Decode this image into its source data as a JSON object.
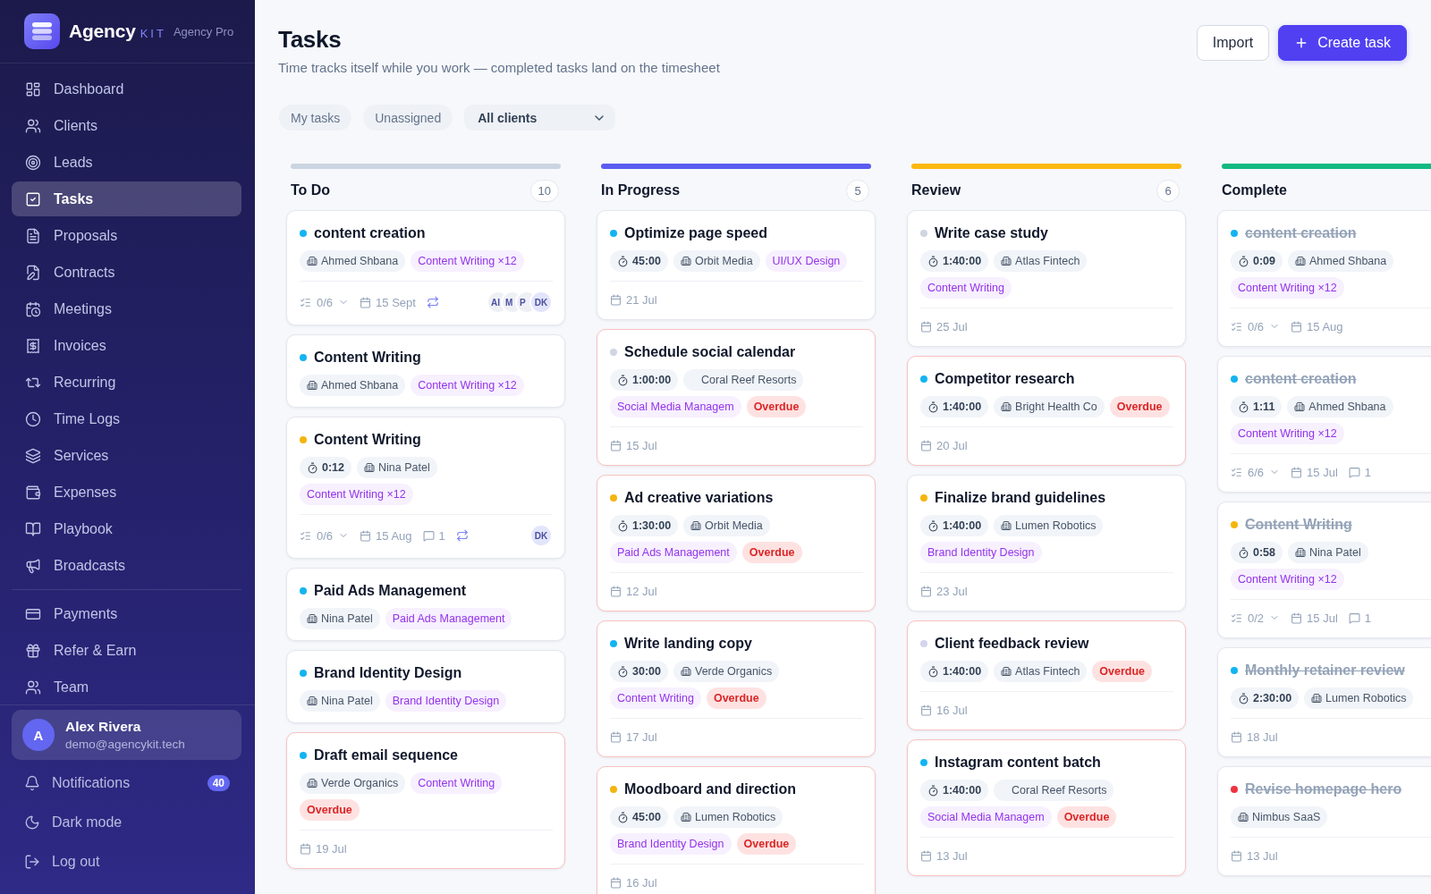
{
  "sidebar": {
    "brand": {
      "name": "Agency",
      "suffix": "KIT",
      "plan": "Agency Pro"
    },
    "nav": [
      {
        "label": "Dashboard",
        "selected": false
      },
      {
        "label": "Clients",
        "selected": false
      },
      {
        "label": "Leads",
        "selected": false
      },
      {
        "label": "Tasks",
        "selected": true
      },
      {
        "label": "Proposals",
        "selected": false
      },
      {
        "label": "Contracts",
        "selected": false
      },
      {
        "label": "Meetings",
        "selected": false
      },
      {
        "label": "Invoices",
        "selected": false
      },
      {
        "label": "Recurring",
        "selected": false
      },
      {
        "label": "Time Logs",
        "selected": false
      },
      {
        "label": "Services",
        "selected": false
      },
      {
        "label": "Expenses",
        "selected": false
      },
      {
        "label": "Playbook",
        "selected": false
      },
      {
        "label": "Broadcasts",
        "selected": false
      }
    ],
    "nav_secondary": [
      {
        "label": "Payments",
        "selected": false
      },
      {
        "label": "Refer & Earn",
        "selected": false
      },
      {
        "label": "Team",
        "selected": false
      }
    ],
    "user": {
      "initial": "A",
      "name": "Alex Rivera",
      "email": "demo@agencykit.tech"
    },
    "footer_links": [
      {
        "label": "Notifications",
        "badge": "40"
      },
      {
        "label": "Dark mode"
      },
      {
        "label": "Log out"
      }
    ]
  },
  "header": {
    "title": "Tasks",
    "subtitle": "Time tracks itself while you work — completed tasks land on the timesheet",
    "actions": [
      {
        "label": "Import",
        "kind": "secondary"
      },
      {
        "label": "Create task",
        "kind": "primary"
      }
    ]
  },
  "filters": {
    "toggles": [
      {
        "label": "My tasks",
        "selected": false
      },
      {
        "label": "Unassigned",
        "selected": false
      }
    ],
    "client_select": {
      "value": "All clients"
    }
  },
  "board": {
    "columns": [
      {
        "title": "To Do",
        "count": "10",
        "color": "#cbd5e1",
        "cards": [
          {
            "title": "content creation",
            "color": "#13b4f2",
            "done": false,
            "overdue": false,
            "chip_rows": [
              [
                {
                  "kind": "client",
                  "text": "Ahmed Shbana"
                },
                {
                  "kind": "tag",
                  "text": "Content Writing ×12"
                }
              ]
            ],
            "footer": {
              "checklist": "0/6",
              "date": "15 Sept",
              "recurring": true,
              "assignees": [
                {
                  "initials": "AI",
                  "color": "#eef0f6"
                },
                {
                  "initials": "M",
                  "color": "#eef0f6"
                },
                {
                  "initials": "P",
                  "color": "#eef0f6"
                },
                {
                  "initials": "DK",
                  "color": "#e2e5fb"
                }
              ]
            }
          },
          {
            "title": "Content Writing",
            "color": "#13b4f2",
            "done": false,
            "overdue": false,
            "chip_rows": [
              [
                {
                  "kind": "client",
                  "text": "Ahmed Shbana"
                },
                {
                  "kind": "tag",
                  "text": "Content Writing ×12"
                }
              ]
            ]
          },
          {
            "title": "Content Writing",
            "color": "#f5b50f",
            "done": false,
            "overdue": false,
            "chip_rows": [
              [
                {
                  "kind": "timer",
                  "text": "0:12"
                },
                {
                  "kind": "client",
                  "text": "Nina Patel"
                }
              ],
              [
                {
                  "kind": "tag",
                  "text": "Content Writing ×12"
                }
              ]
            ],
            "footer": {
              "checklist": "0/6",
              "date": "15 Aug",
              "comments": "1",
              "recurring": true,
              "assignees": [
                {
                  "initials": "DK",
                  "color": "#e2e5fb"
                }
              ]
            }
          },
          {
            "title": "Paid Ads Management",
            "color": "#13b4f2",
            "done": false,
            "overdue": false,
            "chip_rows": [
              [
                {
                  "kind": "client",
                  "text": "Nina Patel"
                },
                {
                  "kind": "tag",
                  "text": "Paid Ads Management"
                }
              ]
            ]
          },
          {
            "title": "Brand Identity Design",
            "color": "#13b4f2",
            "done": false,
            "overdue": false,
            "chip_rows": [
              [
                {
                  "kind": "client",
                  "text": "Nina Patel"
                },
                {
                  "kind": "tag",
                  "text": "Brand Identity Design"
                }
              ]
            ]
          },
          {
            "title": "Draft email sequence",
            "color": "#13b4f2",
            "done": false,
            "overdue": true,
            "chip_rows": [
              [
                {
                  "kind": "client",
                  "text": "Verde Organics"
                },
                {
                  "kind": "tag",
                  "text": "Content Writing"
                }
              ],
              [
                {
                  "kind": "overdue",
                  "text": "Overdue"
                }
              ]
            ],
            "footer": {
              "date": "19 Jul"
            }
          }
        ]
      },
      {
        "title": "In Progress",
        "count": "5",
        "color": "#5b5cf0",
        "cards": [
          {
            "title": "Optimize page speed",
            "color": "#13b4f2",
            "done": false,
            "overdue": false,
            "chip_rows": [
              [
                {
                  "kind": "timer",
                  "text": "45:00"
                },
                {
                  "kind": "client",
                  "text": "Orbit Media"
                },
                {
                  "kind": "tag",
                  "text": "UI/UX Design"
                }
              ]
            ],
            "footer": {
              "date": "21 Jul"
            }
          },
          {
            "title": "Schedule social calendar",
            "color": "#cfd6e2",
            "done": false,
            "overdue": true,
            "chip_rows": [
              [
                {
                  "kind": "timer",
                  "text": "1:00:00"
                },
                {
                  "kind": "plain",
                  "text": "Coral Reef Resorts"
                }
              ],
              [
                {
                  "kind": "tag",
                  "text": "Social Media Managem"
                },
                {
                  "kind": "overdue",
                  "text": "Overdue"
                }
              ]
            ],
            "footer": {
              "date": "15 Jul"
            }
          },
          {
            "title": "Ad creative variations",
            "color": "#f5b50f",
            "done": false,
            "overdue": true,
            "chip_rows": [
              [
                {
                  "kind": "timer",
                  "text": "1:30:00"
                },
                {
                  "kind": "client",
                  "text": "Orbit Media"
                }
              ],
              [
                {
                  "kind": "tag",
                  "text": "Paid Ads Management"
                },
                {
                  "kind": "overdue",
                  "text": "Overdue"
                }
              ]
            ],
            "footer": {
              "date": "12 Jul"
            }
          },
          {
            "title": "Write landing copy",
            "color": "#13b4f2",
            "done": false,
            "overdue": true,
            "chip_rows": [
              [
                {
                  "kind": "timer",
                  "text": "30:00"
                },
                {
                  "kind": "client",
                  "text": "Verde Organics"
                }
              ],
              [
                {
                  "kind": "tag",
                  "text": "Content Writing"
                },
                {
                  "kind": "overdue",
                  "text": "Overdue"
                }
              ]
            ],
            "footer": {
              "date": "17 Jul"
            }
          },
          {
            "title": "Moodboard and direction",
            "color": "#f5b50f",
            "done": false,
            "overdue": true,
            "chip_rows": [
              [
                {
                  "kind": "timer",
                  "text": "45:00"
                },
                {
                  "kind": "client",
                  "text": "Lumen Robotics"
                }
              ],
              [
                {
                  "kind": "tag",
                  "text": "Brand Identity Design"
                },
                {
                  "kind": "overdue",
                  "text": "Overdue"
                }
              ]
            ],
            "footer": {
              "date": "16 Jul"
            }
          }
        ]
      },
      {
        "title": "Review",
        "count": "6",
        "color": "#fbb80f",
        "cards": [
          {
            "title": "Write case study",
            "color": "#cfd6e2",
            "done": false,
            "overdue": false,
            "chip_rows": [
              [
                {
                  "kind": "timer",
                  "text": "1:40:00"
                },
                {
                  "kind": "client",
                  "text": "Atlas Fintech"
                }
              ],
              [
                {
                  "kind": "tag",
                  "text": "Content Writing"
                }
              ]
            ],
            "footer": {
              "date": "25 Jul"
            }
          },
          {
            "title": "Competitor research",
            "color": "#13b4f2",
            "done": false,
            "overdue": true,
            "chip_rows": [
              [
                {
                  "kind": "timer",
                  "text": "1:40:00"
                },
                {
                  "kind": "client",
                  "text": "Bright Health Co"
                },
                {
                  "kind": "overdue",
                  "text": "Overdue"
                }
              ]
            ],
            "footer": {
              "date": "20 Jul"
            }
          },
          {
            "title": "Finalize brand guidelines",
            "color": "#f5b50f",
            "done": false,
            "overdue": false,
            "chip_rows": [
              [
                {
                  "kind": "timer",
                  "text": "1:40:00"
                },
                {
                  "kind": "client",
                  "text": "Lumen Robotics"
                }
              ],
              [
                {
                  "kind": "tag",
                  "text": "Brand Identity Design"
                }
              ]
            ],
            "footer": {
              "date": "23 Jul"
            }
          },
          {
            "title": "Client feedback review",
            "color": "#d3d4ee",
            "done": false,
            "overdue": true,
            "chip_rows": [
              [
                {
                  "kind": "timer",
                  "text": "1:40:00"
                },
                {
                  "kind": "client",
                  "text": "Atlas Fintech"
                },
                {
                  "kind": "overdue",
                  "text": "Overdue"
                }
              ]
            ],
            "footer": {
              "date": "16 Jul"
            }
          },
          {
            "title": "Instagram content batch",
            "color": "#13b4f2",
            "done": false,
            "overdue": true,
            "chip_rows": [
              [
                {
                  "kind": "timer",
                  "text": "1:40:00"
                },
                {
                  "kind": "plain",
                  "text": "Coral Reef Resorts"
                }
              ],
              [
                {
                  "kind": "tag",
                  "text": "Social Media Managem"
                },
                {
                  "kind": "overdue",
                  "text": "Overdue"
                }
              ]
            ],
            "footer": {
              "date": "13 Jul"
            }
          }
        ]
      },
      {
        "title": "Complete",
        "color": "#12b981",
        "cards": [
          {
            "title": "content creation",
            "color": "#13b4f2",
            "done": true,
            "overdue": false,
            "chip_rows": [
              [
                {
                  "kind": "timer",
                  "text": "0:09"
                },
                {
                  "kind": "client",
                  "text": "Ahmed Shbana"
                }
              ],
              [
                {
                  "kind": "tag",
                  "text": "Content Writing ×12"
                }
              ]
            ],
            "footer": {
              "checklist": "0/6",
              "date": "15 Aug"
            }
          },
          {
            "title": "content creation",
            "color": "#13b4f2",
            "done": true,
            "overdue": false,
            "chip_rows": [
              [
                {
                  "kind": "timer",
                  "text": "1:11"
                },
                {
                  "kind": "client",
                  "text": "Ahmed Shbana"
                }
              ],
              [
                {
                  "kind": "tag",
                  "text": "Content Writing ×12"
                }
              ]
            ],
            "footer": {
              "checklist": "6/6",
              "date": "15 Jul",
              "comments": "1"
            }
          },
          {
            "title": "Content Writing",
            "color": "#f5b50f",
            "done": true,
            "overdue": false,
            "chip_rows": [
              [
                {
                  "kind": "timer",
                  "text": "0:58"
                },
                {
                  "kind": "client",
                  "text": "Nina Patel"
                }
              ],
              [
                {
                  "kind": "tag",
                  "text": "Content Writing ×12"
                }
              ]
            ],
            "footer": {
              "checklist": "0/2",
              "date": "15 Jul",
              "comments": "1"
            }
          },
          {
            "title": "Monthly retainer review",
            "color": "#13b4f2",
            "done": true,
            "overdue": false,
            "chip_rows": [
              [
                {
                  "kind": "timer",
                  "text": "2:30:00"
                },
                {
                  "kind": "client",
                  "text": "Lumen Robotics"
                }
              ]
            ],
            "footer": {
              "date": "18 Jul"
            }
          },
          {
            "title": "Revise homepage hero",
            "color": "#ef3340",
            "done": true,
            "overdue": false,
            "chip_rows": [
              [
                {
                  "kind": "client",
                  "text": "Nimbus SaaS"
                }
              ]
            ],
            "footer": {
              "date": "13 Jul"
            }
          }
        ]
      }
    ]
  }
}
